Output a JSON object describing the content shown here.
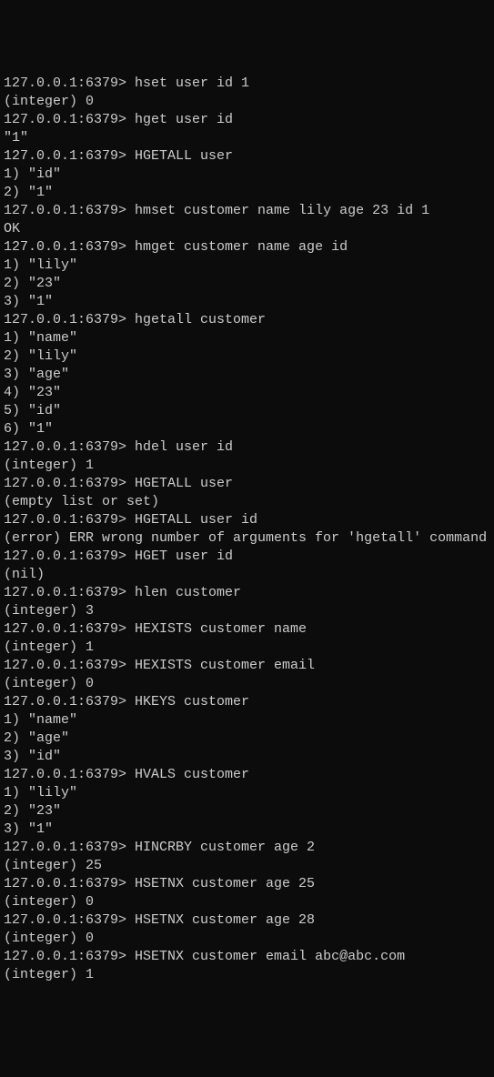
{
  "prompt": "127.0.0.1:6379> ",
  "lines": [
    {
      "type": "cmd",
      "command": "hset user id 1"
    },
    {
      "type": "out",
      "text": "(integer) 0"
    },
    {
      "type": "cmd",
      "command": "hget user id"
    },
    {
      "type": "out",
      "text": "\"1\""
    },
    {
      "type": "cmd",
      "command": "HGETALL user"
    },
    {
      "type": "out",
      "text": "1) \"id\""
    },
    {
      "type": "out",
      "text": "2) \"1\""
    },
    {
      "type": "cmd",
      "command": "hmset customer name lily age 23 id 1"
    },
    {
      "type": "out",
      "text": "OK"
    },
    {
      "type": "cmd",
      "command": "hmget customer name age id"
    },
    {
      "type": "out",
      "text": "1) \"lily\""
    },
    {
      "type": "out",
      "text": "2) \"23\""
    },
    {
      "type": "out",
      "text": "3) \"1\""
    },
    {
      "type": "cmd",
      "command": "hgetall customer"
    },
    {
      "type": "out",
      "text": "1) \"name\""
    },
    {
      "type": "out",
      "text": "2) \"lily\""
    },
    {
      "type": "out",
      "text": "3) \"age\""
    },
    {
      "type": "out",
      "text": "4) \"23\""
    },
    {
      "type": "out",
      "text": "5) \"id\""
    },
    {
      "type": "out",
      "text": "6) \"1\""
    },
    {
      "type": "cmd",
      "command": "hdel user id"
    },
    {
      "type": "out",
      "text": "(integer) 1"
    },
    {
      "type": "cmd",
      "command": "HGETALL user"
    },
    {
      "type": "out",
      "text": "(empty list or set)"
    },
    {
      "type": "cmd",
      "command": "HGETALL user id"
    },
    {
      "type": "out",
      "text": "(error) ERR wrong number of arguments for 'hgetall' command"
    },
    {
      "type": "cmd",
      "command": "HGET user id"
    },
    {
      "type": "out",
      "text": "(nil)"
    },
    {
      "type": "cmd",
      "command": "hlen customer"
    },
    {
      "type": "out",
      "text": "(integer) 3"
    },
    {
      "type": "cmd",
      "command": "HEXISTS customer name"
    },
    {
      "type": "out",
      "text": "(integer) 1"
    },
    {
      "type": "cmd",
      "command": "HEXISTS customer email"
    },
    {
      "type": "out",
      "text": "(integer) 0"
    },
    {
      "type": "cmd",
      "command": "HKEYS customer"
    },
    {
      "type": "out",
      "text": "1) \"name\""
    },
    {
      "type": "out",
      "text": "2) \"age\""
    },
    {
      "type": "out",
      "text": "3) \"id\""
    },
    {
      "type": "cmd",
      "command": "HVALS customer"
    },
    {
      "type": "out",
      "text": "1) \"lily\""
    },
    {
      "type": "out",
      "text": "2) \"23\""
    },
    {
      "type": "out",
      "text": "3) \"1\""
    },
    {
      "type": "cmd",
      "command": "HINCRBY customer age 2"
    },
    {
      "type": "out",
      "text": "(integer) 25"
    },
    {
      "type": "cmd",
      "command": "HSETNX customer age 25"
    },
    {
      "type": "out",
      "text": "(integer) 0"
    },
    {
      "type": "cmd",
      "command": "HSETNX customer age 28"
    },
    {
      "type": "out",
      "text": "(integer) 0"
    },
    {
      "type": "cmd",
      "command": "HSETNX customer email abc@abc.com"
    },
    {
      "type": "out",
      "text": "(integer) 1"
    }
  ]
}
